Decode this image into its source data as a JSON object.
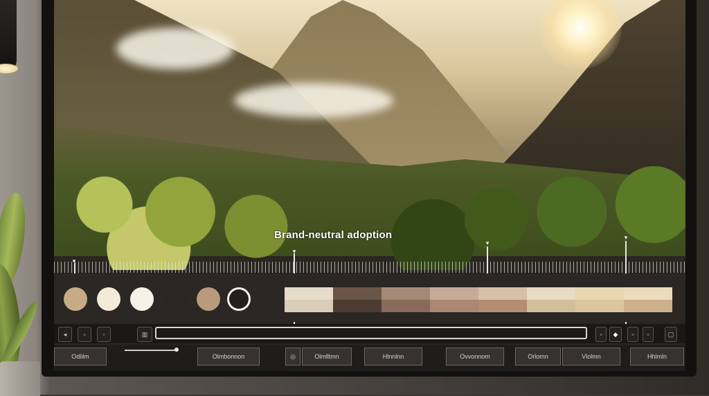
{
  "overlay": {
    "title": "Brand-neutral adoption"
  },
  "palette": {
    "swatches": [
      "#c7ab85",
      "#f3ead8",
      "#f7f2e8",
      "#2b2624",
      "#b99a7c",
      "#241f1d"
    ],
    "selected_index": 5
  },
  "strip": {
    "top": [
      "#e6dccb",
      "#6a5648",
      "#a38a78",
      "#c6ab98",
      "#d6c0a7",
      "#e9dcc5",
      "#e8d5b1",
      "#eadcbc"
    ],
    "bottom": [
      "#d9cdb8",
      "#4c3b32",
      "#886b5a",
      "#a98772",
      "#b48e72",
      "#d3be9b",
      "#dcc59d",
      "#cdb18a"
    ]
  },
  "toolbar": {
    "left_icons": [
      "speaker-icon",
      "square-icon",
      "circle-icon",
      "film-icon"
    ],
    "right_icons": [
      "box-icon",
      "diamond-icon",
      "dash-icon",
      "square-icon"
    ]
  },
  "bottombar": {
    "buttons": [
      "Odlilm",
      "Olmbonnon",
      "Olmlltmn",
      "Hlnnlnn",
      "Ovvonnom",
      "Orlomn",
      "Vlolmn",
      "Hhlmln"
    ]
  }
}
